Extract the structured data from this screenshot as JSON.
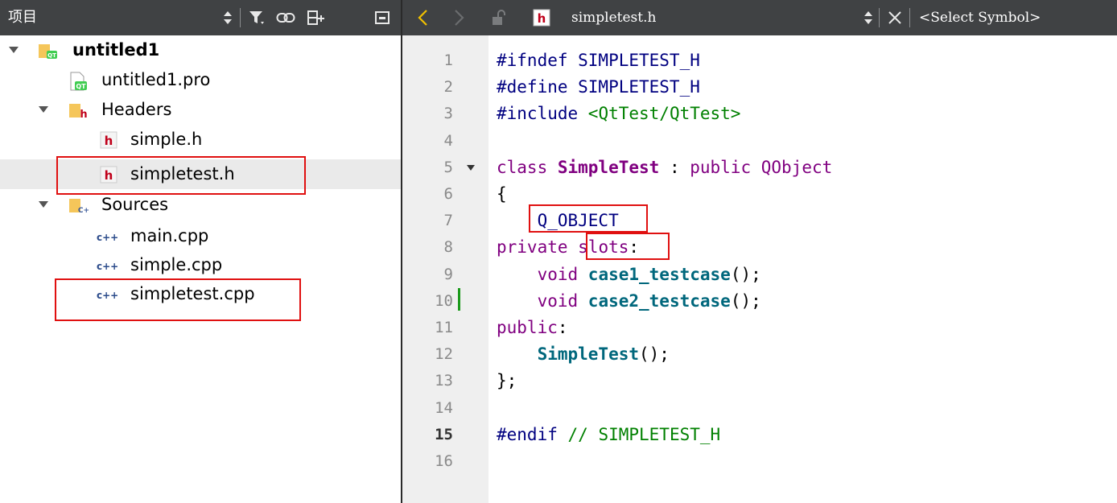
{
  "left_toolbar": {
    "title": "项目",
    "icons": [
      "updown-arrows-icon",
      "filter-icon",
      "link-icon",
      "split-add-icon",
      "close-pane-icon"
    ]
  },
  "right_toolbar": {
    "back_icon": "chevron-left-icon",
    "forward_icon": "chevron-right-icon",
    "lock_icon": "unlock-icon",
    "file_type_icon": "header-file-icon",
    "filename": "simpletest.h",
    "close_icon": "close-icon",
    "symbol_selector": "<Select Symbol>"
  },
  "project_tree": [
    {
      "label": "untitled1",
      "icon": "qt-project-folder-icon",
      "expanded": true,
      "bold": true
    },
    {
      "label": "untitled1.pro",
      "icon": "qt-pro-file-icon"
    },
    {
      "label": "Headers",
      "icon": "headers-folder-icon",
      "expanded": true
    },
    {
      "label": "simple.h",
      "icon": "header-file-icon"
    },
    {
      "label": "simpletest.h",
      "icon": "header-file-icon",
      "selected": true
    },
    {
      "label": "Sources",
      "icon": "sources-folder-icon",
      "expanded": true
    },
    {
      "label": "main.cpp",
      "icon": "cpp-file-icon"
    },
    {
      "label": "simple.cpp",
      "icon": "cpp-file-icon"
    },
    {
      "label": "simpletest.cpp",
      "icon": "cpp-file-icon"
    }
  ],
  "editor": {
    "current_line": 15,
    "lines": [
      {
        "n": "1",
        "tokens": [
          [
            "pre",
            "#ifndef SIMPLETEST_H"
          ]
        ]
      },
      {
        "n": "2",
        "tokens": [
          [
            "pre",
            "#define SIMPLETEST_H"
          ]
        ]
      },
      {
        "n": "3",
        "tokens": [
          [
            "pre",
            "#include "
          ],
          [
            "str",
            "<QtTest/QtTest>"
          ]
        ]
      },
      {
        "n": "4",
        "tokens": []
      },
      {
        "n": "5",
        "tokens": [
          [
            "kw",
            "class "
          ],
          [
            "cls",
            "SimpleTest"
          ],
          [
            "plain",
            " : "
          ],
          [
            "kw",
            "public "
          ],
          [
            "kw",
            "QObject"
          ]
        ]
      },
      {
        "n": "6",
        "tokens": [
          [
            "plain",
            "{"
          ]
        ]
      },
      {
        "n": "7",
        "tokens": [
          [
            "plain",
            "    "
          ],
          [
            "mac",
            "Q_OBJECT"
          ]
        ]
      },
      {
        "n": "8",
        "tokens": [
          [
            "kw",
            "private "
          ],
          [
            "kw",
            "slots"
          ],
          [
            "plain",
            ":"
          ]
        ]
      },
      {
        "n": "9",
        "tokens": [
          [
            "plain",
            "    "
          ],
          [
            "kw",
            "void "
          ],
          [
            "fn",
            "case1_testcase"
          ],
          [
            "plain",
            "();"
          ]
        ]
      },
      {
        "n": "10",
        "tokens": [
          [
            "plain",
            "    "
          ],
          [
            "kw",
            "void "
          ],
          [
            "fn",
            "case2_testcase"
          ],
          [
            "plain",
            "();"
          ]
        ]
      },
      {
        "n": "11",
        "tokens": [
          [
            "kw",
            "public"
          ],
          [
            "plain",
            ":"
          ]
        ]
      },
      {
        "n": "12",
        "tokens": [
          [
            "plain",
            "    "
          ],
          [
            "fn",
            "SimpleTest"
          ],
          [
            "plain",
            "();"
          ]
        ]
      },
      {
        "n": "13",
        "tokens": [
          [
            "plain",
            "};"
          ]
        ]
      },
      {
        "n": "14",
        "tokens": []
      },
      {
        "n": "15",
        "tokens": [
          [
            "pre",
            "#endif "
          ],
          [
            "cmt",
            "// SIMPLETEST_H"
          ]
        ]
      },
      {
        "n": "16",
        "tokens": []
      }
    ]
  },
  "colors": {
    "toolbar_bg": "#404244",
    "gutter_bg": "#efefef",
    "highlight_box": "#e01010",
    "preprocessor": "#000080",
    "keyword": "#800080",
    "function": "#00677c",
    "string": "#008000"
  }
}
